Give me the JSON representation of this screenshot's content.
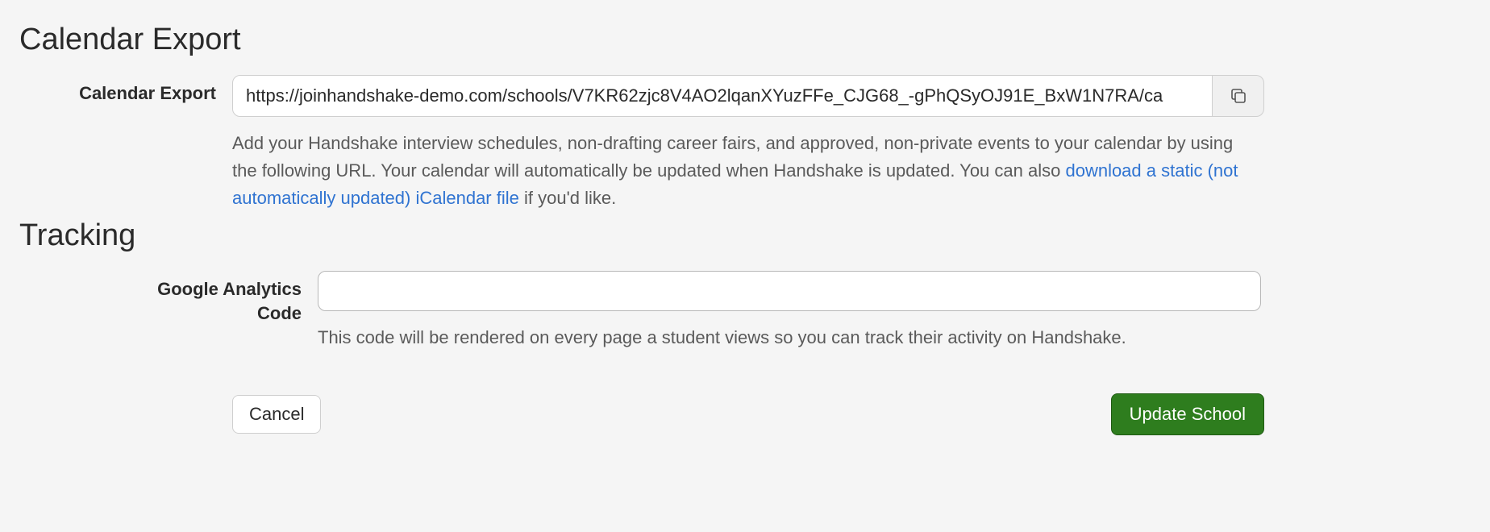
{
  "calendarExport": {
    "heading": "Calendar Export",
    "label": "Calendar Export",
    "url": "https://joinhandshake-demo.com/schools/V7KR62zjc8V4AO2lqanXYuzFFe_CJG68_-gPhQSyOJ91E_BxW1N7RA/ca",
    "helpTextPrefix": "Add your Handshake interview schedules, non-drafting career fairs, and approved, non-private events to your calendar by using the following URL. Your calendar will automatically be updated when Handshake is updated. You can also ",
    "helpLinkText": "download a static (not automatically updated) iCalendar file",
    "helpTextSuffix": " if you'd like."
  },
  "tracking": {
    "heading": "Tracking",
    "label1": "Google Analytics",
    "label2": "Code",
    "value": "",
    "helpText": "This code will be rendered on every page a student views so you can track their activity on Handshake."
  },
  "buttons": {
    "cancel": "Cancel",
    "submit": "Update School"
  }
}
